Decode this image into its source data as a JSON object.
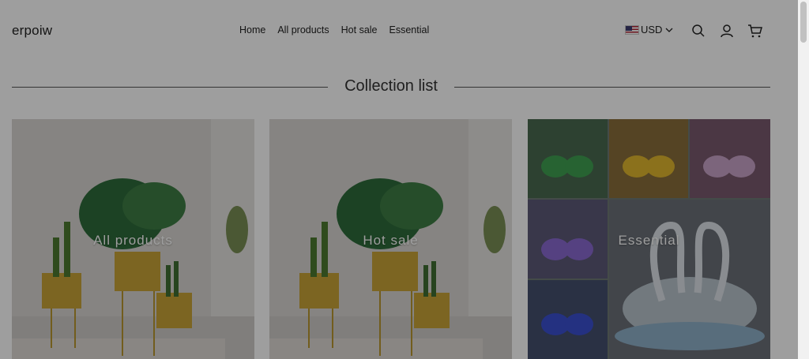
{
  "header": {
    "logo": "erpoiw",
    "nav": [
      "Home",
      "All products",
      "Hot sale",
      "Essential"
    ],
    "currency": "USD",
    "icons": [
      "search-icon",
      "account-icon",
      "cart-icon"
    ]
  },
  "section": {
    "title": "Collection list"
  },
  "collections": [
    {
      "label": "All products"
    },
    {
      "label": "Hot sale"
    },
    {
      "label": "Essential"
    }
  ],
  "colors": {
    "overlay": "#000000",
    "text": "#222222",
    "divider": "#555555"
  }
}
